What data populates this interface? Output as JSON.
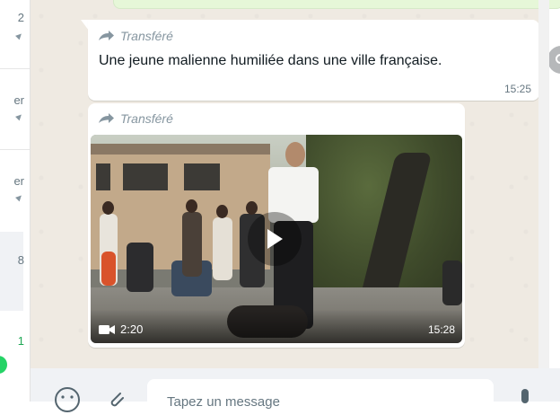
{
  "chat_list": {
    "items": [
      {
        "time_fragment": "2"
      },
      {
        "time_fragment": "er"
      },
      {
        "time_fragment": "er"
      },
      {
        "time_fragment": "8"
      },
      {
        "time_fragment": "1"
      }
    ]
  },
  "messages": [
    {
      "forwarded_label": "Transféré",
      "text": "Une jeune malienne humiliée dans une ville française.",
      "time": "15:25"
    },
    {
      "forwarded_label": "Transféré",
      "video_duration": "2:20",
      "time": "15:28",
      "play_icon": "play-icon"
    }
  ],
  "composer": {
    "placeholder": "Tapez un message",
    "icons": [
      "emoji-icon",
      "attach-icon",
      "mic-icon"
    ]
  },
  "colors": {
    "chat_bg": "#efeae2",
    "bubble_in": "#ffffff",
    "badge": "#25d366",
    "meta_text": "#667781"
  }
}
